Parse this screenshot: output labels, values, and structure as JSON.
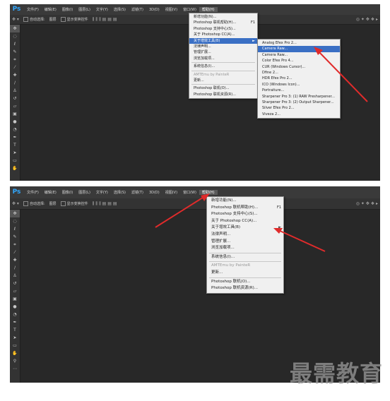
{
  "app": {
    "logo": "Ps"
  },
  "menubar": {
    "items": [
      "文件(F)",
      "编辑(E)",
      "图像(I)",
      "图层(L)",
      "文字(Y)",
      "选择(S)",
      "滤镜(T)",
      "3D(D)",
      "视图(V)",
      "窗口(W)",
      "帮助(H)"
    ]
  },
  "options": {
    "auto_select": "自动选择:",
    "layer": "图层",
    "show_transform": "显示变换控件"
  },
  "help_menu": {
    "items": [
      {
        "label": "新增功能(N)..."
      },
      {
        "label": "Photoshop 联机帮助(H)...",
        "shortcut": "F1"
      },
      {
        "label": "Photoshop 支持中心(S)..."
      },
      {
        "label": "关于 Photoshop CC(A)..."
      },
      {
        "label": "关于增效工具(B)",
        "submenu_arrow": "►"
      },
      {
        "label": "法律声明..."
      },
      {
        "label": "管理扩展..."
      },
      {
        "label": "浏览加载项..."
      },
      {
        "label": "系统信息(I)..."
      },
      {
        "label": "AMTEmu by PainteR"
      },
      {
        "label": "更新..."
      },
      {
        "label": "Photoshop 联机(O)..."
      },
      {
        "label": "Photoshop 联机资源(R)..."
      }
    ]
  },
  "plugins_submenu": {
    "items": [
      "Analog Efex Pro 2...",
      "Camera Raw...",
      "Camera Raw...",
      "Color Efex Pro 4...",
      "CUR (Windows Cursor)...",
      "Dfine 2...",
      "HDR Efex Pro 2...",
      "ICO (Windows Icon)...",
      "Portraiture...",
      "Sharpener Pro 3: (1) RAW Presharpener...",
      "Sharpener Pro 3: (2) Output Sharpener...",
      "Silver Efex Pro 2...",
      "Viveza 2..."
    ]
  },
  "watermark": "最需教育",
  "colors": {
    "highlight": "#3a6fc4",
    "annotation_arrow": "#e02b2b",
    "workspace": "#282828"
  },
  "icons": [
    "move-tool-icon",
    "marquee-tool-icon",
    "lasso-tool-icon",
    "quick-select-tool-icon",
    "crop-tool-icon",
    "eyedropper-tool-icon",
    "healing-brush-icon",
    "brush-tool-icon",
    "clone-stamp-icon",
    "history-brush-icon",
    "eraser-tool-icon",
    "gradient-tool-icon",
    "blur-tool-icon",
    "dodge-tool-icon",
    "pen-tool-icon",
    "type-tool-icon",
    "path-select-icon",
    "shape-tool-icon",
    "hand-tool-icon",
    "zoom-tool-icon"
  ]
}
